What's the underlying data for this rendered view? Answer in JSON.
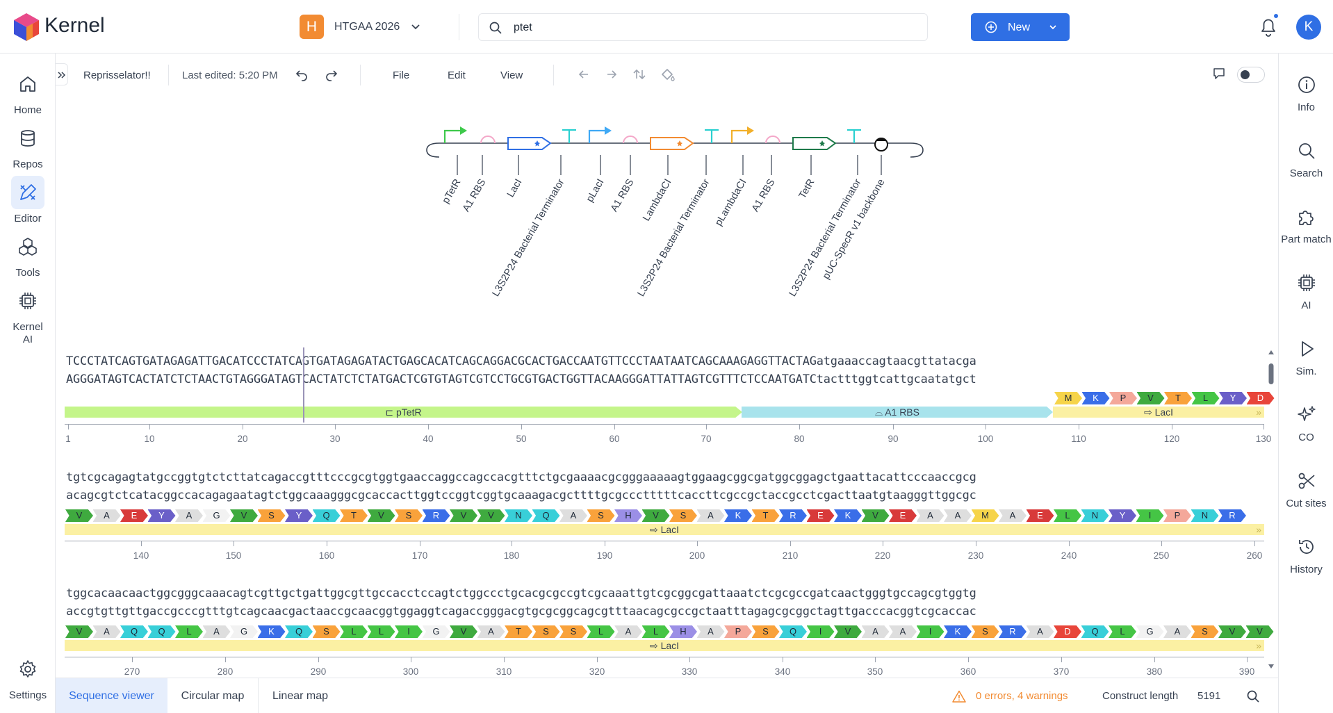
{
  "app": {
    "brand": "Kernel"
  },
  "project": {
    "initial": "H",
    "name": "HTGAA 2026"
  },
  "search": {
    "value": "ptet"
  },
  "new_button": {
    "label": "New"
  },
  "user": {
    "initial": "K"
  },
  "left_nav": [
    {
      "label": "Home"
    },
    {
      "label": "Repos"
    },
    {
      "label": "Editor"
    },
    {
      "label": "Tools"
    },
    {
      "label": "Kernel",
      "label2": "AI"
    },
    {
      "label": "Settings"
    }
  ],
  "right_nav": [
    {
      "label": "Info"
    },
    {
      "label": "Search"
    },
    {
      "label": "Part match"
    },
    {
      "label": "AI"
    },
    {
      "label": "Sim."
    },
    {
      "label": "CO"
    },
    {
      "label": "Cut sites"
    },
    {
      "label": "History"
    }
  ],
  "toolbar": {
    "doc_name": "Reprisselator!!",
    "last_edited": "Last edited: 5:20 PM",
    "menus": [
      "File",
      "Edit",
      "View"
    ]
  },
  "map_labels": [
    "pTetR",
    "A1 RBS",
    "LacI",
    "L3S2P24 Bacterial Terminator",
    "pLacI",
    "A1 RBS",
    "LambdaCI",
    "L3S2P24 Bacterial Terminator",
    "pLambdaCI",
    "A1 RBS",
    "TetR",
    "L3S2P24 Bacterial Terminator",
    "pUC-SpecR v1 backbone"
  ],
  "sequence": {
    "rows": [
      {
        "top": "TCCCTATCAGTGATAGAGATTGACATCCCTATCAGTGATAGAGATACTGAGCACATCAGCAGGACGCACTGACCAATGTTCCCTAATAATCAGCAAAGAGGTTACTAGatgaaaccagtaacgttatacga",
        "bottom": "AGGGATAGTCACTATCTCTAACTGTAGGGATAGTCACTATCTCTATGACTCGTGTAGTCGTCCTGCGTGACTGGTTACAAGGGATTATTAGTCGTTTCTCCAATGATCtactttggtcattgcaatatgct",
        "aa_label": "MKPVTLYD",
        "features": [
          {
            "label": "pTetR"
          },
          {
            "label": "A1 RBS"
          },
          {
            "label": "LacI"
          }
        ],
        "ticks": [
          "1",
          "10",
          "20",
          "30",
          "40",
          "50",
          "60",
          "70",
          "80",
          "90",
          "100",
          "110",
          "120",
          "130"
        ]
      },
      {
        "top": "tgtcgcagagtatgccggtgtctcttatcagaccgtttcccgcgtggtgaaccaggccagccacgtttctgcgaaaacgcgggaaaaagtggaagcggcgatggcggagctgaattacattcccaaccgcg",
        "bottom": "acagcgtctcatacggccacagagaatagtctggcaaagggcgcaccacttggtccggtcggtgcaaagacgcttttgcgccctttttcaccttcgccgctaccgcctcgacttaatgtaagggttggcgc",
        "aa_label": "VAEYAGVSYQTVSRVVNQASHVSAKTREKVEAAMAELNYIPNR",
        "features": [
          {
            "label": "LacI"
          }
        ],
        "ticks": [
          "140",
          "150",
          "160",
          "170",
          "180",
          "190",
          "200",
          "210",
          "220",
          "230",
          "240",
          "250",
          "260"
        ]
      },
      {
        "top": "tggcacaacaactggcgggcaaacagtcgttgctgattggcgttgccacctccagtctggccctgcacgcgccgtcgcaaattgtcgcggcgattaaatctcgcgccgatcaactgggtgccagcgtggtg",
        "bottom": "accgtgttgttgaccgcccgtttgtcagcaacgactaaccgcaacggtggaggtcagaccgggacgtgcgcggcagcgtttaacagcgccgctaatttagagcgcggctagttgacccacggtcgcaccac",
        "aa_label": "VAQQLAGKQSLLIGVATSSLALHAPSQIVAAIKSRADQLGASVV",
        "features": [
          {
            "label": "LacI"
          }
        ],
        "ticks": [
          "270",
          "280",
          "290",
          "300",
          "310",
          "320",
          "330",
          "340",
          "350",
          "360",
          "370",
          "380",
          "390"
        ]
      }
    ]
  },
  "aa_colors": {
    "M": "#f6d44a",
    "K": "#3a6ee8",
    "P": "#f4a89a",
    "V": "#3faa3f",
    "T": "#f9a23b",
    "L": "#45c545",
    "Y": "#6a5fc8",
    "D": "#e8453a",
    "A": "#dedede",
    "E": "#d83a3a",
    "G": "#f2f2f2",
    "S": "#f9a23b",
    "Q": "#38cfd8",
    "R": "#3a6ee8",
    "N": "#38cfd8",
    "H": "#9b8fe6",
    "I": "#45c545"
  },
  "bottom": {
    "tabs": [
      "Sequence viewer",
      "Circular map",
      "Linear map"
    ],
    "warnings": "0 errors, 4 warnings",
    "construct_label": "Construct length",
    "construct_length": "5191"
  },
  "colors": {
    "accent": "#2f6fe4",
    "project_badge": "#f28b32",
    "warning": "#f28b32",
    "ptetr": "#c4f58a",
    "a1rbs": "#a8e3ec",
    "laci": "#fbf0a3"
  }
}
